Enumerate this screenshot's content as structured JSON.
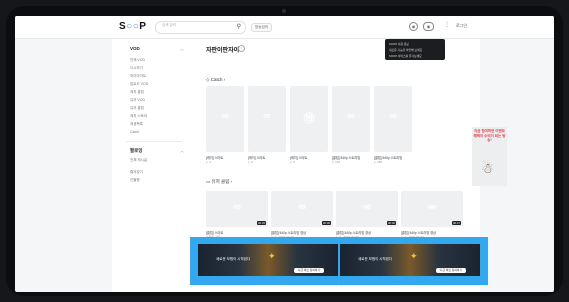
{
  "header": {
    "logo": "SOOP",
    "search_placeholder": "검색 입력",
    "filter_label": "방송검색",
    "login_label": "로그인"
  },
  "sidebar": {
    "vod_title": "VOD",
    "vod_items": [
      "전체 VOD",
      "다시보기",
      "하이라이트",
      "업로드 VOD",
      "캐치 클립",
      "유저 VOD",
      "유저 클립",
      "캐치 스토리",
      "재생목록",
      "Catch"
    ],
    "follow_title": "팔로잉",
    "follow_items": [
      "전체 게시글",
      "즐겨찾기",
      "선물함"
    ]
  },
  "main": {
    "channel_title": "자판이판자이",
    "catch_title": "Catch",
    "catch_cards": [
      {
        "title": "[캐치] 스타트",
        "sub": "▷ 3"
      },
      {
        "title": "[캐치] 스타트",
        "sub": "▷ 2"
      },
      {
        "title": "[캐치] 스타트",
        "sub": "▷ 5"
      },
      {
        "title": "[클립] 540p 스트리밍",
        "sub": "▷ 132"
      },
      {
        "title": "[클립] 540p 스트리밍",
        "sub": "▷ 366"
      }
    ],
    "clip_title": "유저 클립",
    "clips": [
      {
        "title": "[클립] 스타트",
        "sub1": "스타트 저장",
        "sub2": "▷ 2 · 2023-09-21",
        "dur": "00:45"
      },
      {
        "title": "[클립] 540p 스트리밍 영상",
        "sub1": "",
        "sub2": "▷ 7 · 2023-09-20",
        "dur": "00:30"
      },
      {
        "title": "[클립] 540p 스트리밍 영상",
        "sub1": "",
        "sub2": "▷ 3 · 2023-09-20",
        "dur": "00:30"
      },
      {
        "title": "[클립] 540p 스트리밍 영상",
        "sub1": "",
        "sub2": "▷ 4 · 2023-09-20",
        "dur": "00:47"
      }
    ]
  },
  "tooltip": {
    "lines": [
      "SOOP 사용 정보",
      "새로운 기능을 확인해 보세요",
      "SOOP 서비스를 즐겨보세요"
    ]
  },
  "side_ad": {
    "text": "지금 참여하면 이벤트 혜택이 수익이 되는 방송!"
  },
  "banner": {
    "caption": "새로운 모험이 시작된다",
    "cta": "지금 바로 참여하기"
  },
  "colors": {
    "accent": "#4a8af4",
    "banner_bg": "#33a8ee"
  }
}
